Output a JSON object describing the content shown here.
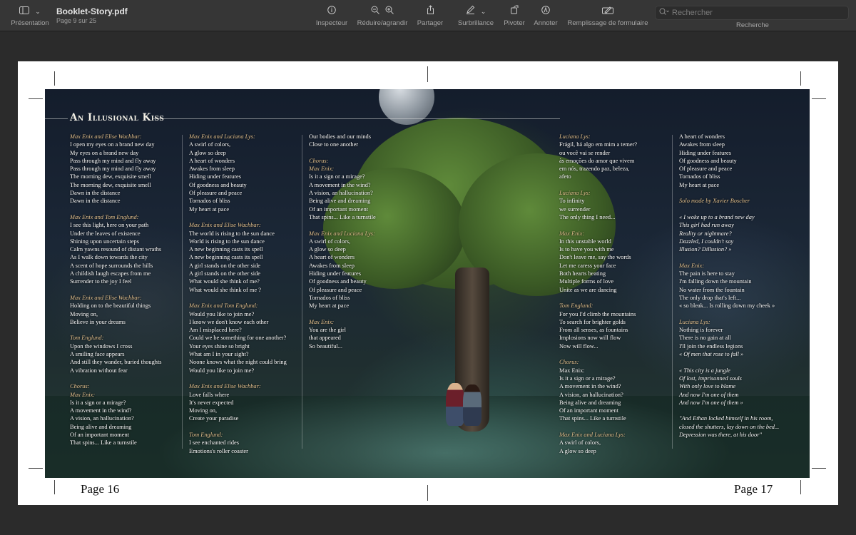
{
  "toolbar": {
    "presentation_label": "Présentation",
    "document_title": "Booklet-Story.pdf",
    "page_indicator": "Page 9 sur 25",
    "inspector_label": "Inspecteur",
    "zoom_label": "Réduire/agrandir",
    "share_label": "Partager",
    "highlight_label": "Surbrillance",
    "rotate_label": "Pivoter",
    "annotate_label": "Annoter",
    "form_fill_label": "Remplissage de formulaire",
    "search_label": "Recherche",
    "search_placeholder": "Rechercher"
  },
  "spread": {
    "title": "An Illusional Kiss",
    "page_left": "Page 16",
    "page_right": "Page 17",
    "columns": [
      [
        {
          "t": "s",
          "v": "Max Enix and Elise Wachbar:"
        },
        {
          "t": "l",
          "v": "I open my eyes on a brand new day"
        },
        {
          "t": "l",
          "v": "My eyes on a brand new day"
        },
        {
          "t": "l",
          "v": "Pass through my mind and fly away"
        },
        {
          "t": "l",
          "v": "Pass through my mind and fly away"
        },
        {
          "t": "l",
          "v": "The morning dew, exquisite smell"
        },
        {
          "t": "l",
          "v": "The morning dew, exquisite smell"
        },
        {
          "t": "l",
          "v": "Dawn in the distance"
        },
        {
          "t": "l",
          "v": "Dawn in the distance"
        },
        {
          "t": "g"
        },
        {
          "t": "s",
          "v": "Max Enix and Tom Englund:"
        },
        {
          "t": "l",
          "v": "I see this light, here on your path"
        },
        {
          "t": "l",
          "v": "Under the leaves of existence"
        },
        {
          "t": "l",
          "v": "Shining upon uncertain steps"
        },
        {
          "t": "l",
          "v": "Calm yawns resound of distant wraths"
        },
        {
          "t": "l",
          "v": "As I walk down towards the city"
        },
        {
          "t": "l",
          "v": "A scent of hope surrounds the hills"
        },
        {
          "t": "l",
          "v": "A childish laugh escapes from me"
        },
        {
          "t": "l",
          "v": "Surrender to the joy I feel"
        },
        {
          "t": "g"
        },
        {
          "t": "s",
          "v": "Max Enix and Elise Wachbar:"
        },
        {
          "t": "l",
          "v": "Holding on to the beautiful things"
        },
        {
          "t": "l",
          "v": "Moving on,"
        },
        {
          "t": "l",
          "v": "Believe in your dreams"
        },
        {
          "t": "g"
        },
        {
          "t": "s",
          "v": "Tom Englund:"
        },
        {
          "t": "l",
          "v": "Upon the windows I cross"
        },
        {
          "t": "l",
          "v": "A smiling face appears"
        },
        {
          "t": "l",
          "v": "And still they wander, buried thoughts"
        },
        {
          "t": "l",
          "v": "A vibration without fear"
        },
        {
          "t": "g"
        },
        {
          "t": "s",
          "v": "Chorus:"
        },
        {
          "t": "s",
          "v": "Max Enix:"
        },
        {
          "t": "l",
          "v": "Is it a sign or a mirage?"
        },
        {
          "t": "l",
          "v": "A movement in the wind?"
        },
        {
          "t": "l",
          "v": "A vision, an hallucination?"
        },
        {
          "t": "l",
          "v": "Being alive and dreaming"
        },
        {
          "t": "l",
          "v": "Of an important moment"
        },
        {
          "t": "l",
          "v": "That spins... Like a turnstile"
        }
      ],
      [
        {
          "t": "s",
          "v": "Max Enix and Luciana Lys:"
        },
        {
          "t": "l",
          "v": "A swirl of colors,"
        },
        {
          "t": "l",
          "v": "A glow so deep"
        },
        {
          "t": "l",
          "v": "A heart of wonders"
        },
        {
          "t": "l",
          "v": "Awakes from sleep"
        },
        {
          "t": "l",
          "v": "Hiding under features"
        },
        {
          "t": "l",
          "v": "Of goodness and beauty"
        },
        {
          "t": "l",
          "v": "Of pleasure and peace"
        },
        {
          "t": "l",
          "v": "Tornados of bliss"
        },
        {
          "t": "l",
          "v": "My heart at pace"
        },
        {
          "t": "g"
        },
        {
          "t": "s",
          "v": "Max Enix and Elise Wachbar:"
        },
        {
          "t": "l",
          "v": "The world is rising to the sun dance"
        },
        {
          "t": "l",
          "v": "World is rising to the sun dance"
        },
        {
          "t": "l",
          "v": "A new beginning casts its spell"
        },
        {
          "t": "l",
          "v": "A new beginning casts its spell"
        },
        {
          "t": "l",
          "v": "A girl stands on the other side"
        },
        {
          "t": "l",
          "v": "A girl stands on the other side"
        },
        {
          "t": "l",
          "v": "What would she think of me?"
        },
        {
          "t": "l",
          "v": "What would she think of me ?"
        },
        {
          "t": "g"
        },
        {
          "t": "s",
          "v": "Max Enix and Tom Englund:"
        },
        {
          "t": "l",
          "v": "Would you like to join me?"
        },
        {
          "t": "l",
          "v": "I know we don't know each other"
        },
        {
          "t": "l",
          "v": "Am I misplaced here?"
        },
        {
          "t": "l",
          "v": "Could we be something for one another?"
        },
        {
          "t": "l",
          "v": "Your eyes shine so bright"
        },
        {
          "t": "l",
          "v": "What am I in your sight?"
        },
        {
          "t": "l",
          "v": "Noone knows what the night could bring"
        },
        {
          "t": "l",
          "v": "Would you like to join me?"
        },
        {
          "t": "g"
        },
        {
          "t": "s",
          "v": "Max Enix and Elise Wachbar:"
        },
        {
          "t": "l",
          "v": "Love falls where"
        },
        {
          "t": "l",
          "v": "It's never expected"
        },
        {
          "t": "l",
          "v": "Moving on,"
        },
        {
          "t": "l",
          "v": "Create your paradise"
        },
        {
          "t": "g"
        },
        {
          "t": "s",
          "v": "Tom Englund:"
        },
        {
          "t": "l",
          "v": "I see enchanted rides"
        },
        {
          "t": "l",
          "v": "Emotions's roller coaster"
        }
      ],
      [
        {
          "t": "l",
          "v": "Our bodies and our minds"
        },
        {
          "t": "l",
          "v": "Close to one another"
        },
        {
          "t": "g"
        },
        {
          "t": "s",
          "v": "Chorus:"
        },
        {
          "t": "s",
          "v": "Max Enix:"
        },
        {
          "t": "l",
          "v": "Is it a sign or a mirage?"
        },
        {
          "t": "l",
          "v": "A movement in the wind?"
        },
        {
          "t": "l",
          "v": "A vision, an hallucination?"
        },
        {
          "t": "l",
          "v": "Being alive and dreaming"
        },
        {
          "t": "l",
          "v": "Of an important moment"
        },
        {
          "t": "l",
          "v": "That spins... Like a turnstile"
        },
        {
          "t": "g"
        },
        {
          "t": "s",
          "v": "Max Enix and Luciana Lys:"
        },
        {
          "t": "l",
          "v": "A swirl of colors,"
        },
        {
          "t": "l",
          "v": "A glow so deep"
        },
        {
          "t": "l",
          "v": "A heart of wonders"
        },
        {
          "t": "l",
          "v": "Awakes from sleep"
        },
        {
          "t": "l",
          "v": "Hiding under features"
        },
        {
          "t": "l",
          "v": "Of goodness and beauty"
        },
        {
          "t": "l",
          "v": "Of pleasure and peace"
        },
        {
          "t": "l",
          "v": "Tornados of bliss"
        },
        {
          "t": "l",
          "v": "My heart at pace"
        },
        {
          "t": "g"
        },
        {
          "t": "s",
          "v": "Max Enix:"
        },
        {
          "t": "l",
          "v": "You are the girl"
        },
        {
          "t": "l",
          "v": "that appeared"
        },
        {
          "t": "l",
          "v": "So beautiful..."
        }
      ],
      [
        {
          "t": "s",
          "v": "Luciana Lys:"
        },
        {
          "t": "l",
          "v": "Frágil, há algo em mim a temer?"
        },
        {
          "t": "l",
          "v": "ou você vai se render"
        },
        {
          "t": "l",
          "v": "às emoções do amor que vivem"
        },
        {
          "t": "l",
          "v": "em nós, trazendo paz, beleza,"
        },
        {
          "t": "l",
          "v": "afeto"
        },
        {
          "t": "g"
        },
        {
          "t": "s",
          "v": "Luciana Lys:"
        },
        {
          "t": "l",
          "v": "To infinity"
        },
        {
          "t": "l",
          "v": "we surrender"
        },
        {
          "t": "l",
          "v": "The only thing I need..."
        },
        {
          "t": "g"
        },
        {
          "t": "s",
          "v": "Max Enix:"
        },
        {
          "t": "l",
          "v": "In this unstable world"
        },
        {
          "t": "l",
          "v": "Is to have you with me"
        },
        {
          "t": "l",
          "v": "Don't leave me, say the words"
        },
        {
          "t": "l",
          "v": "Let me caress your face"
        },
        {
          "t": "l",
          "v": "Both hearts beating"
        },
        {
          "t": "l",
          "v": "Multiple forms of love"
        },
        {
          "t": "l",
          "v": "Unite as we are dancing"
        },
        {
          "t": "g"
        },
        {
          "t": "s",
          "v": "Tom Englund:"
        },
        {
          "t": "l",
          "v": "For you I'd climb the mountains"
        },
        {
          "t": "l",
          "v": "To search for brighter golds"
        },
        {
          "t": "l",
          "v": "From all senses, as fountains"
        },
        {
          "t": "l",
          "v": "Implosions now will flow"
        },
        {
          "t": "l",
          "v": "Now will flow..."
        },
        {
          "t": "g"
        },
        {
          "t": "s",
          "v": "Chorus:"
        },
        {
          "t": "l",
          "v": "Max Enix:"
        },
        {
          "t": "l",
          "v": "Is it a sign or a mirage?"
        },
        {
          "t": "l",
          "v": "A movement in the wind?"
        },
        {
          "t": "l",
          "v": "A vision, an hallucination?"
        },
        {
          "t": "l",
          "v": "Being alive and dreaming"
        },
        {
          "t": "l",
          "v": "Of an important moment"
        },
        {
          "t": "l",
          "v": "That spins... Like a turnstile"
        },
        {
          "t": "g"
        },
        {
          "t": "s",
          "v": "Max Enix and Luciana Lys:"
        },
        {
          "t": "l",
          "v": "A swirl of colors,"
        },
        {
          "t": "l",
          "v": "A glow so deep"
        }
      ],
      [
        {
          "t": "l",
          "v": "A heart of wonders"
        },
        {
          "t": "l",
          "v": "Awakes from sleep"
        },
        {
          "t": "l",
          "v": "Hiding under features"
        },
        {
          "t": "l",
          "v": "Of goodness and beauty"
        },
        {
          "t": "l",
          "v": "Of pleasure and peace"
        },
        {
          "t": "l",
          "v": "Tornados of bliss"
        },
        {
          "t": "l",
          "v": "My heart at pace"
        },
        {
          "t": "g"
        },
        {
          "t": "s",
          "v": "Solo made by Xavier Boscher"
        },
        {
          "t": "g"
        },
        {
          "t": "i",
          "v": "« I woke up to a brand new day"
        },
        {
          "t": "i",
          "v": "This girl had run away"
        },
        {
          "t": "i",
          "v": "Reality or nightmare?"
        },
        {
          "t": "i",
          "v": "Dazzled, I couldn't say"
        },
        {
          "t": "i",
          "v": "Illusion? Dillusion? »"
        },
        {
          "t": "g"
        },
        {
          "t": "s",
          "v": "Max Enix:"
        },
        {
          "t": "l",
          "v": "The pain is here to stay"
        },
        {
          "t": "l",
          "v": "I'm falling down the mountain"
        },
        {
          "t": "l",
          "v": "No water from the fountain"
        },
        {
          "t": "l",
          "v": "The only drop that's left..."
        },
        {
          "t": "l",
          "v": "« so bleak... Is rolling down my cheek »"
        },
        {
          "t": "g"
        },
        {
          "t": "s",
          "v": "Luciana Lys:"
        },
        {
          "t": "l",
          "v": "Nothing is forever"
        },
        {
          "t": "l",
          "v": "There is no gain at all"
        },
        {
          "t": "l",
          "v": "I'll join the endless legions"
        },
        {
          "t": "i",
          "v": "« Of men that rose to fall »"
        },
        {
          "t": "g"
        },
        {
          "t": "i",
          "v": "« This city is a jungle"
        },
        {
          "t": "i",
          "v": "Of lost, imprisonned souls"
        },
        {
          "t": "i",
          "v": "With only love to blame"
        },
        {
          "t": "i",
          "v": "And now I'm one of them"
        },
        {
          "t": "i",
          "v": "And now I'm one of them »"
        },
        {
          "t": "g"
        },
        {
          "t": "i",
          "v": "\"And Ethan locked himself in his room,"
        },
        {
          "t": "i",
          "v": "closed the shutters, lay down on the bed..."
        },
        {
          "t": "i",
          "v": "Depression was there, at his door\""
        }
      ]
    ]
  }
}
